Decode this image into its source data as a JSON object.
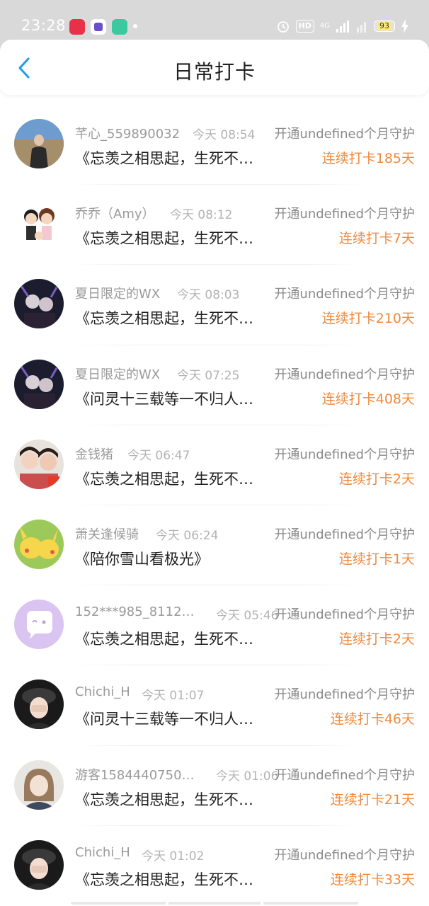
{
  "status_bar": {
    "time": "23:28",
    "net": "4G",
    "battery": "93"
  },
  "header": {
    "title": "日常打卡",
    "back_icon": "chevron-left-icon",
    "accent": "#1d9bf0"
  },
  "colors": {
    "streak": "#f08a3c",
    "name": "#9a9a9a",
    "time": "#b3b3b3"
  },
  "checkins": [
    {
      "name": "芊心_559890032",
      "time": "今天 08:54",
      "guard": "开通undefined个月守护",
      "book": "《忘羡之相思起，生死不…",
      "streak": "连续打卡185天"
    },
    {
      "name": "乔乔（Amy）",
      "time": "今天 08:12",
      "guard": "开通undefined个月守护",
      "book": "《忘羡之相思起，生死不…",
      "streak": "连续打卡7天"
    },
    {
      "name": "夏日限定的WX",
      "time": "今天 08:03",
      "guard": "开通undefined个月守护",
      "book": "《忘羡之相思起，生死不…",
      "streak": "连续打卡210天"
    },
    {
      "name": "夏日限定的WX",
      "time": "今天 07:25",
      "guard": "开通undefined个月守护",
      "book": "《问灵十三载等一不归人…",
      "streak": "连续打卡408天"
    },
    {
      "name": "金钱猪",
      "time": "今天 06:47",
      "guard": "开通undefined个月守护",
      "book": "《忘羡之相思起，生死不…",
      "streak": "连续打卡2天"
    },
    {
      "name": "萧关逢候骑",
      "time": "今天 06:24",
      "guard": "开通undefined个月守护",
      "book": "《陪你雪山看极光》",
      "streak": "连续打卡1天"
    },
    {
      "name": "152***985_81120…",
      "time": "今天 05:46",
      "guard": "开通undefined个月守护",
      "book": "《忘羡之相思起，生死不…",
      "streak": "连续打卡2天"
    },
    {
      "name": "Chichi_H",
      "time": "今天 01:07",
      "guard": "开通undefined个月守护",
      "book": "《问灵十三载等一不归人…",
      "streak": "连续打卡46天"
    },
    {
      "name": "游客15844407500…",
      "time": "今天 01:06",
      "guard": "开通undefined个月守护",
      "book": "《忘羡之相思起，生死不…",
      "streak": "连续打卡21天"
    },
    {
      "name": "Chichi_H",
      "time": "今天 01:02",
      "guard": "开通undefined个月守护",
      "book": "《忘羡之相思起，生死不…",
      "streak": "连续打卡33天"
    }
  ]
}
